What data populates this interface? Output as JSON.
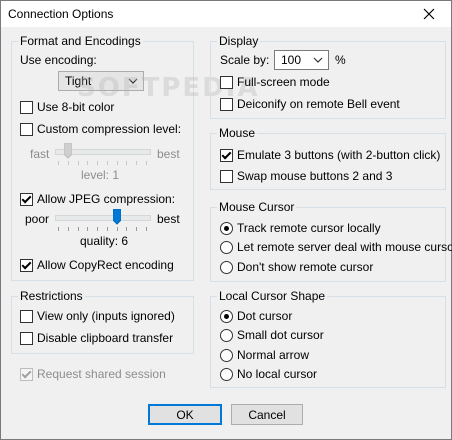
{
  "window": {
    "title": "Connection Options"
  },
  "format": {
    "group_label": "Format and Encodings",
    "use_encoding_label": "Use encoding:",
    "encoding_value": "Tight",
    "use_8bit": {
      "label": "Use 8-bit color",
      "checked": false
    },
    "custom_compression": {
      "label": "Custom compression level:",
      "checked": false
    },
    "compression_slider": {
      "min_label": "fast",
      "max_label": "best",
      "value_text": "level: 1",
      "level": 1,
      "max": 9,
      "disabled": true
    },
    "allow_jpeg": {
      "label": "Allow JPEG compression:",
      "checked": true
    },
    "quality_slider": {
      "min_label": "poor",
      "max_label": "best",
      "value_text": "quality: 6",
      "level": 6,
      "max": 9
    },
    "allow_copyrect": {
      "label": "Allow CopyRect encoding",
      "checked": true
    }
  },
  "watermark": "SOFTPEDIA",
  "restrictions": {
    "group_label": "Restrictions",
    "view_only": {
      "label": "View only (inputs ignored)",
      "checked": false
    },
    "disable_clipboard": {
      "label": "Disable clipboard transfer",
      "checked": false
    }
  },
  "shared_session": {
    "label": "Request shared session",
    "checked": true,
    "disabled": true
  },
  "display": {
    "group_label": "Display",
    "scale_by_label": "Scale by:",
    "scale_value": "100",
    "scale_unit": "%",
    "full_screen": {
      "label": "Full-screen mode",
      "checked": false
    },
    "deiconify": {
      "label": "Deiconify on remote Bell event",
      "checked": false
    }
  },
  "mouse": {
    "group_label": "Mouse",
    "emulate3": {
      "label": "Emulate 3 buttons (with 2-button click)",
      "checked": true
    },
    "swap_buttons": {
      "label": "Swap mouse buttons 2 and 3",
      "checked": false
    }
  },
  "mouse_cursor": {
    "group_label": "Mouse Cursor",
    "options": [
      "Track remote cursor locally",
      "Let remote server deal with mouse cursor",
      "Don't show remote cursor"
    ],
    "selected": 0
  },
  "local_cursor": {
    "group_label": "Local Cursor Shape",
    "options": [
      "Dot cursor",
      "Small dot cursor",
      "Normal arrow",
      "No local cursor"
    ],
    "selected": 0
  },
  "buttons": {
    "ok": "OK",
    "cancel": "Cancel"
  },
  "colors": {
    "accent": "#0078d7",
    "slider_thumb": "#0078d7",
    "disabled_text": "#8d8d8d"
  },
  "icons": {
    "close": "close-icon",
    "dropdown": "chevron-down-icon"
  }
}
